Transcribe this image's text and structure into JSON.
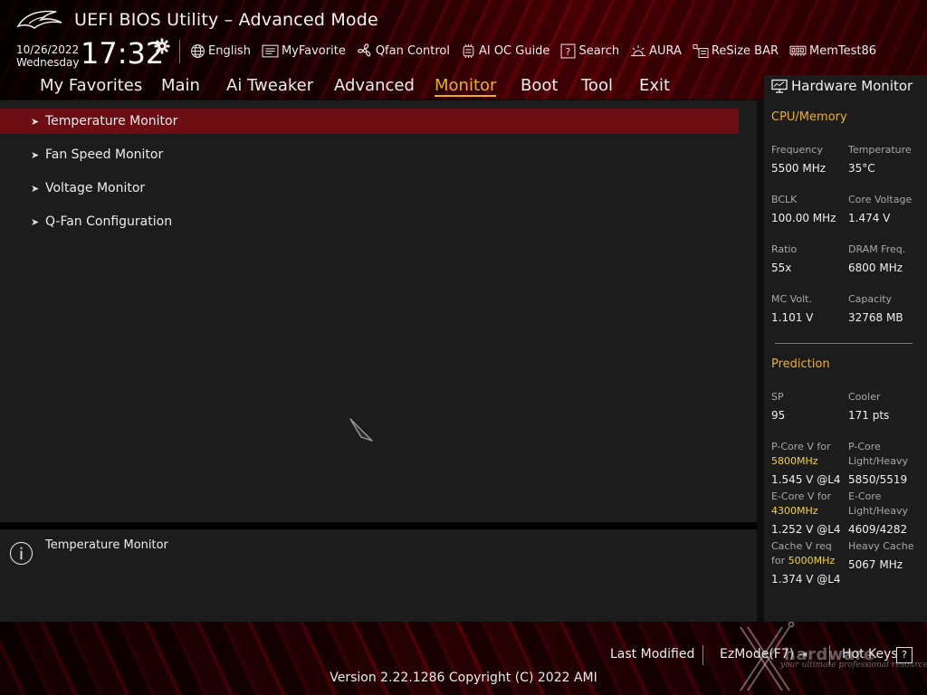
{
  "header": {
    "title": "UEFI BIOS Utility – Advanced Mode",
    "date": "10/26/2022",
    "day": "Wednesday",
    "time": "17:32",
    "links": [
      {
        "label": "English",
        "icon": "globe-icon"
      },
      {
        "label": "MyFavorite",
        "icon": "favorite-list-icon"
      },
      {
        "label": "Qfan Control",
        "icon": "fan-icon"
      },
      {
        "label": "AI OC Guide",
        "icon": "ai-chip-icon"
      },
      {
        "label": "Search",
        "icon": "search-help-icon"
      },
      {
        "label": "AURA",
        "icon": "aura-light-icon"
      },
      {
        "label": "ReSize BAR",
        "icon": "resize-bar-icon"
      },
      {
        "label": "MemTest86",
        "icon": "memory-icon"
      }
    ]
  },
  "nav": {
    "items": [
      "My Favorites",
      "Main",
      "Ai Tweaker",
      "Advanced",
      "Monitor",
      "Boot",
      "Tool",
      "Exit"
    ],
    "active": "Monitor"
  },
  "menu": {
    "items": [
      "Temperature Monitor",
      "Fan Speed Monitor",
      "Voltage Monitor",
      "Q-Fan Configuration"
    ],
    "selected": "Temperature Monitor"
  },
  "help": {
    "text": "Temperature Monitor"
  },
  "hw_monitor": {
    "title": "Hardware Monitor",
    "cpu_section": "CPU/Memory",
    "cpu": [
      {
        "label": "Frequency",
        "value": "5500 MHz"
      },
      {
        "label": "Temperature",
        "value": "35°C"
      },
      {
        "label": "BCLK",
        "value": "100.00 MHz"
      },
      {
        "label": "Core Voltage",
        "value": "1.474 V"
      },
      {
        "label": "Ratio",
        "value": "55x"
      },
      {
        "label": "DRAM Freq.",
        "value": "6800 MHz"
      },
      {
        "label": "MC Volt.",
        "value": "1.101 V"
      },
      {
        "label": "Capacity",
        "value": "32768 MB"
      }
    ],
    "prediction_section": "Prediction",
    "sp_label": "SP",
    "sp_value": "95",
    "cooler_label": "Cooler",
    "cooler_value": "171 pts",
    "pcore_label_1": "P-Core V for",
    "pcore_freq": "5800MHz",
    "pcore_value": "1.545 V @L4",
    "pcore_lh_label_1": "P-Core",
    "pcore_lh_label_2": "Light/Heavy",
    "pcore_lh_value": "5850/5519",
    "ecore_label_1": "E-Core V for",
    "ecore_freq": "4300MHz",
    "ecore_value": "1.252 V @L4",
    "ecore_lh_label_1": "E-Core",
    "ecore_lh_label_2": "Light/Heavy",
    "ecore_lh_value": "4609/4282",
    "cache_label_1": "Cache V req",
    "cache_label_2": "for",
    "cache_freq": "5000MHz",
    "cache_value": "1.374 V @L4",
    "heavy_cache_label": "Heavy Cache",
    "heavy_cache_value": "5067 MHz"
  },
  "footer": {
    "last_modified": "Last Modified",
    "ezmode": "EzMode(F7)",
    "hotkeys": "Hot Keys",
    "hotkey_glyph": "?",
    "version": "Version 2.22.1286 Copyright (C) 2022 AMI"
  },
  "watermark": {
    "brand": "hardware",
    "tagline": "your ultimate professional resource"
  },
  "colors": {
    "accent": "#e8b027",
    "highlight_value": "#f5d530",
    "selected_row": "#6b0d12",
    "panel": "#1c1c1c"
  }
}
